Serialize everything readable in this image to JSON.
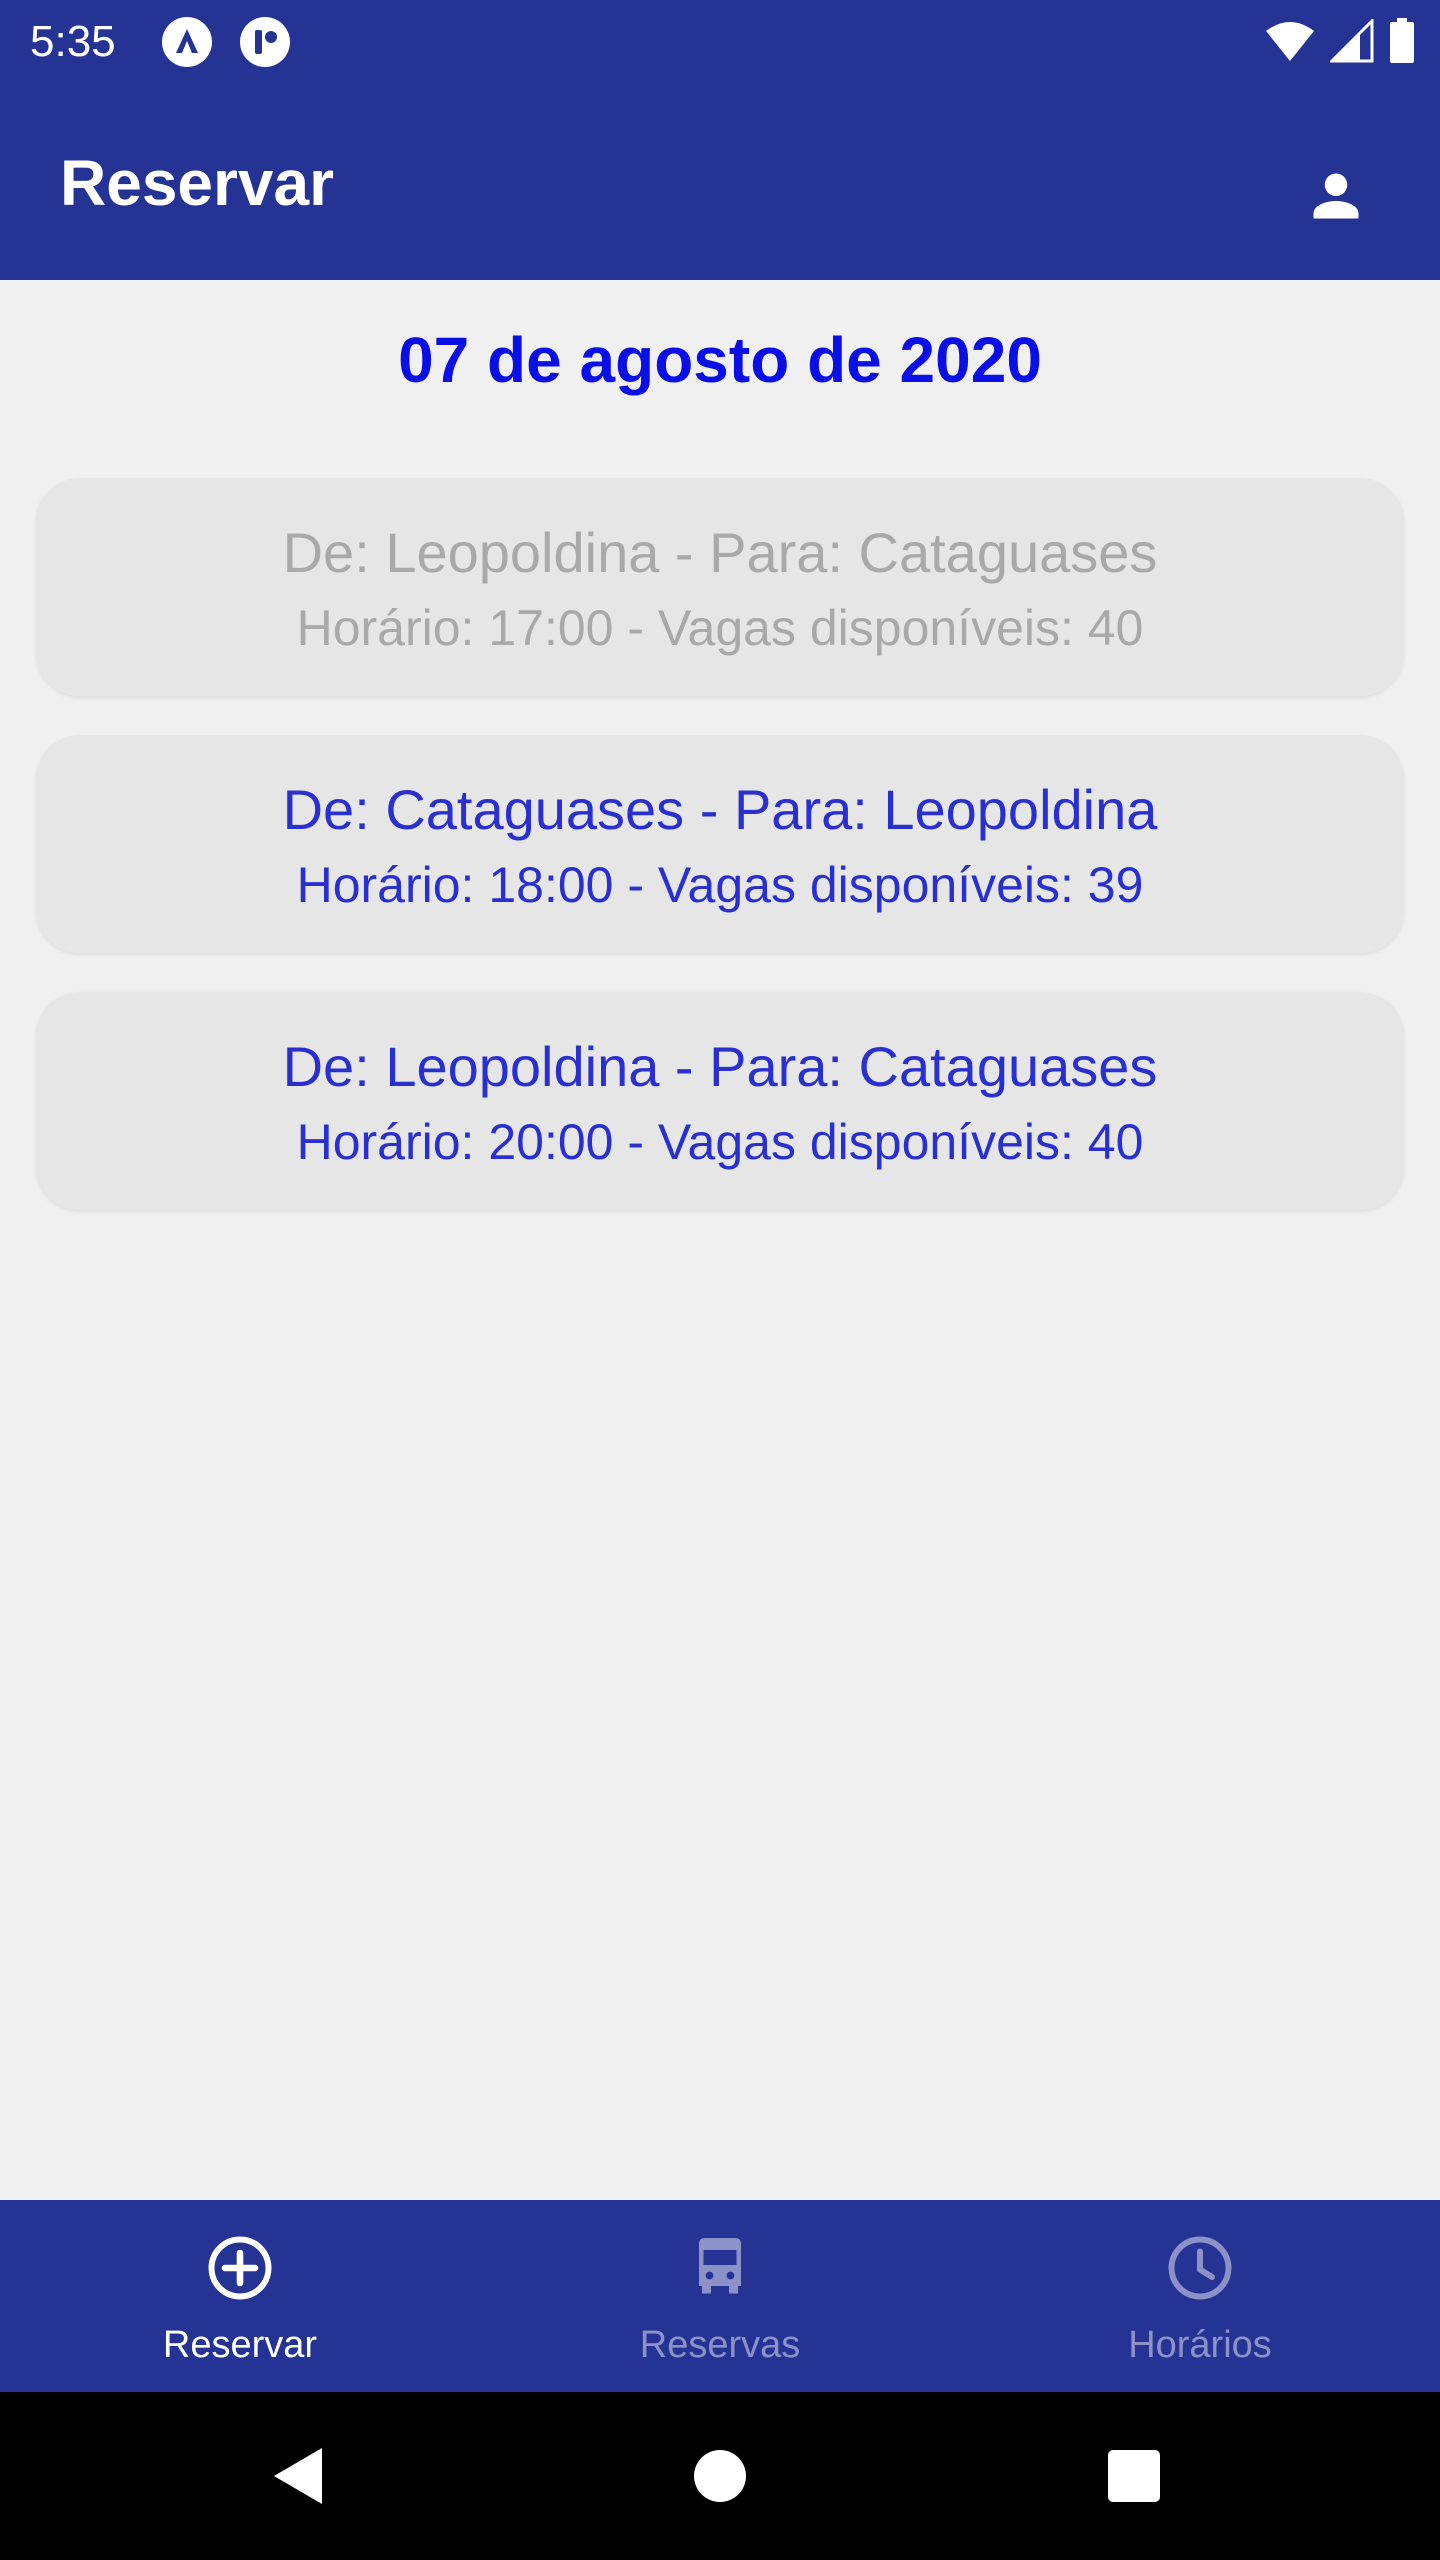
{
  "status_bar": {
    "time": "5:35",
    "icons": [
      "app-notification-icon",
      "app-notification-icon-2",
      "wifi-icon",
      "cell-signal-icon",
      "battery-icon"
    ]
  },
  "app_bar": {
    "title": "Reservar",
    "profile_icon": "person-icon"
  },
  "main": {
    "date": "07 de agosto de 2020",
    "trips": [
      {
        "route": "De: Leopoldina - Para: Cataguases",
        "info": "Horário: 17:00 - Vagas disponíveis: 40",
        "enabled": false
      },
      {
        "route": "De: Cataguases - Para: Leopoldina",
        "info": "Horário: 18:00 - Vagas disponíveis: 39",
        "enabled": true
      },
      {
        "route": "De: Leopoldina - Para: Cataguases",
        "info": "Horário: 20:00 - Vagas disponíveis: 40",
        "enabled": true
      }
    ]
  },
  "bottom_nav": {
    "items": [
      {
        "label": "Reservar",
        "icon": "add-circle-icon",
        "active": true
      },
      {
        "label": "Reservas",
        "icon": "bus-icon",
        "active": false
      },
      {
        "label": "Horários",
        "icon": "clock-icon",
        "active": false
      }
    ]
  },
  "colors": {
    "primary": "#253494",
    "accent_text": "#0a0fe6",
    "trip_text": "#2a30d0",
    "disabled_text": "#a9a9a9",
    "card_bg": "#e6e6e6",
    "background": "#f0f0f0"
  }
}
